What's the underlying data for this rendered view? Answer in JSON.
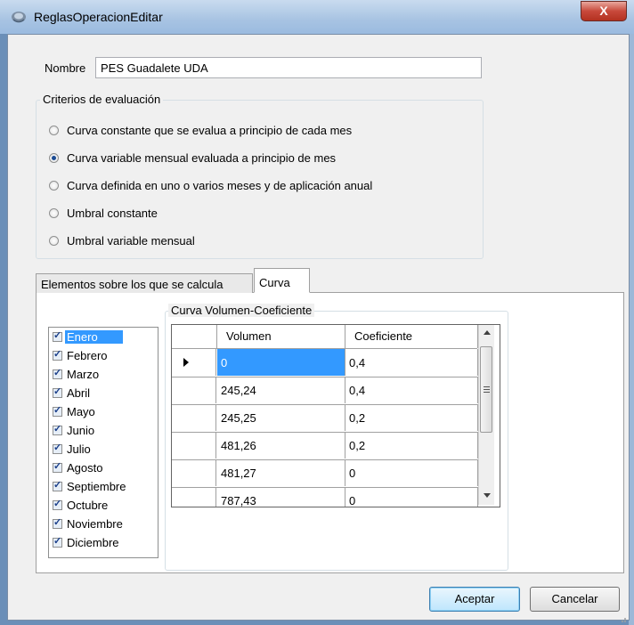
{
  "window": {
    "title": "ReglasOperacionEditar",
    "close_label": "X"
  },
  "nombre": {
    "label": "Nombre",
    "value": "PES Guadalete UDA"
  },
  "criterios": {
    "title": "Criterios de evaluación",
    "options": [
      {
        "label": "Curva constante que se evalua a principio de cada mes",
        "selected": false
      },
      {
        "label": "Curva variable mensual evaluada a principio de mes",
        "selected": true
      },
      {
        "label": "Curva definida en uno o varios meses y de aplicación anual",
        "selected": false
      },
      {
        "label": "Umbral constante",
        "selected": false
      },
      {
        "label": "Umbral variable mensual",
        "selected": false
      }
    ]
  },
  "tabs": [
    {
      "label": "Elementos sobre los que se calcula",
      "active": false
    },
    {
      "label": "Curva",
      "active": true
    }
  ],
  "months": {
    "items": [
      "Enero",
      "Febrero",
      "Marzo",
      "Abril",
      "Mayo",
      "Junio",
      "Julio",
      "Agosto",
      "Septiembre",
      "Octubre",
      "Noviembre",
      "Diciembre"
    ],
    "checked": [
      true,
      true,
      true,
      true,
      true,
      true,
      true,
      true,
      true,
      true,
      true,
      true
    ],
    "selected_index": 0
  },
  "curva": {
    "title": "Curva Volumen-Coeficiente",
    "columns": [
      "Volumen",
      "Coeficiente"
    ],
    "rows": [
      [
        "0",
        "0,4"
      ],
      [
        "245,24",
        "0,4"
      ],
      [
        "245,25",
        "0,2"
      ],
      [
        "481,26",
        "0,2"
      ],
      [
        "481,27",
        "0"
      ],
      [
        "787,43",
        "0"
      ]
    ],
    "current_row": 0
  },
  "buttons": {
    "accept": "Aceptar",
    "cancel": "Cancelar"
  }
}
